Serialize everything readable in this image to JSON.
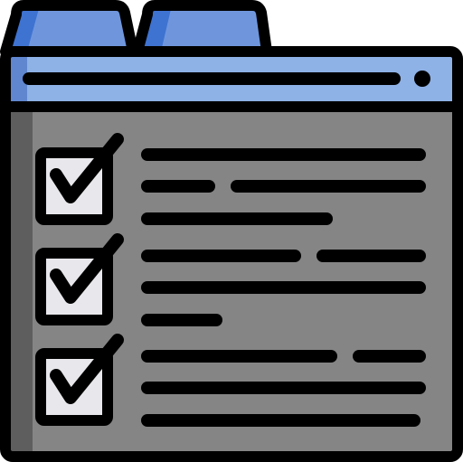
{
  "colors": {
    "outline": "#000000",
    "tab_fill": "#6f96dd",
    "tab_shade": "#3f73d1",
    "titlebar_fill": "#8eb1e6",
    "titlebar_shade": "#5f86cf",
    "body_fill": "#858585",
    "body_shade": "#5e5e5e",
    "checkbox_fill": "#e8e8ec",
    "text_line": "#000000"
  },
  "icons": {
    "window": "browser-window-icon",
    "tab": "folder-tab-icon",
    "checkbox": "checked-checkbox-icon",
    "line": "text-line-placeholder"
  },
  "tabs": [
    {
      "name": "tab-1"
    },
    {
      "name": "tab-2"
    }
  ],
  "checklist": {
    "items": [
      {
        "checked": true,
        "line_count": 3
      },
      {
        "checked": true,
        "line_count": 3
      },
      {
        "checked": true,
        "line_count": 3
      }
    ]
  }
}
